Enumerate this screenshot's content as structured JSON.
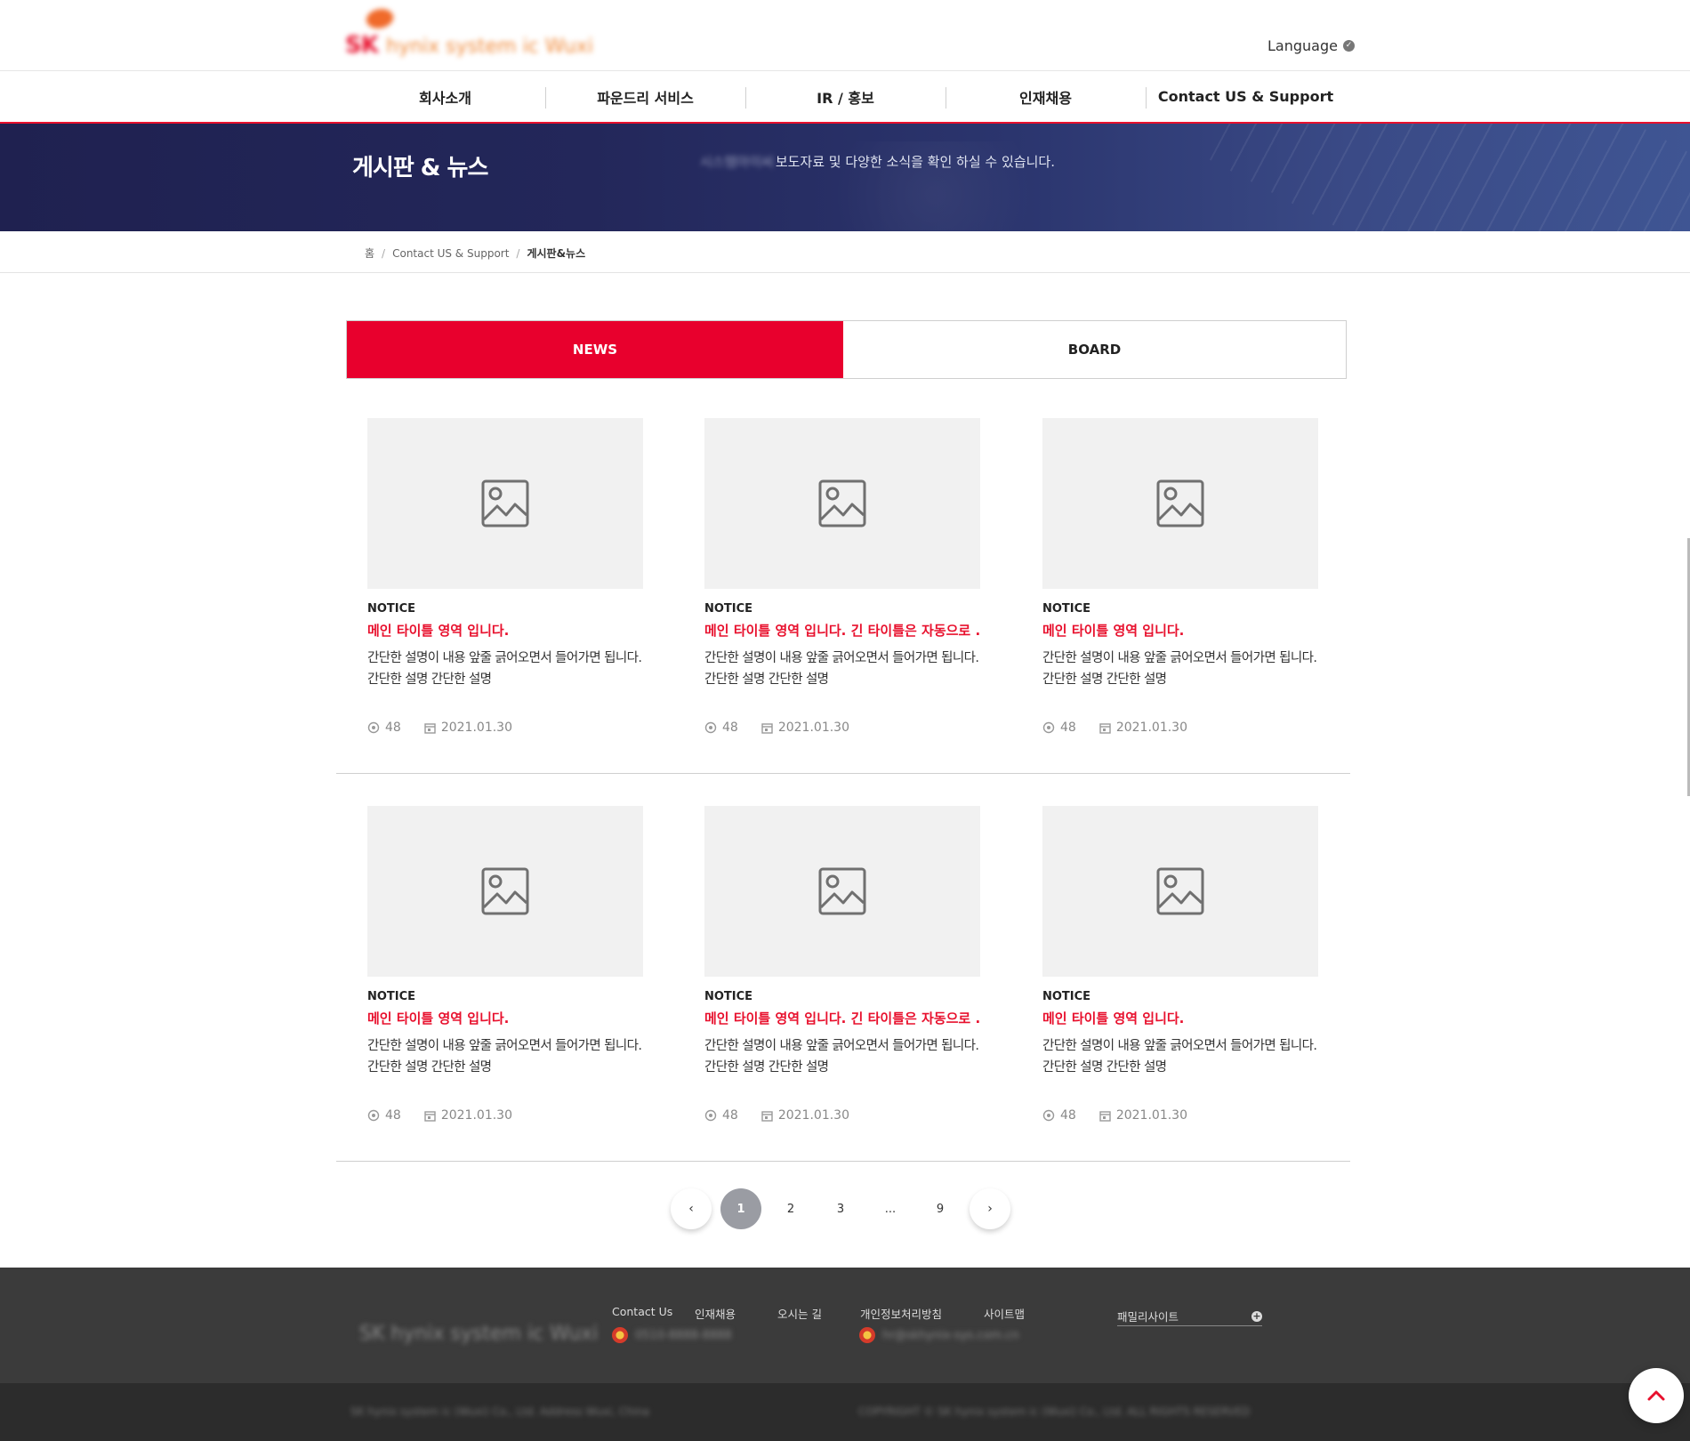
{
  "header": {
    "logo_text": "SK",
    "logo_subtext": "hynix system ic Wuxi",
    "language_label": "Language",
    "nav": [
      "회사소개",
      "파운드리 서비스",
      "IR / 홍보",
      "인재채용",
      "Contact US & Support"
    ]
  },
  "hero": {
    "title": "게시판 & 뉴스",
    "desc_blurred": "시스템아이씨",
    "desc": "보도자료 및 다양한 소식을 확인 하실 수 있습니다."
  },
  "breadcrumb": [
    "홈",
    "Contact US & Support",
    "게시판&뉴스"
  ],
  "tabs": {
    "active": "NEWS",
    "inactive": "BOARD"
  },
  "cards": [
    {
      "category": "NOTICE",
      "title": "메인 타이틀 영역 입니다.",
      "desc": "간단한 설명이 내용 앞줄 긁어오면서 들어가면 됩니다. 간단한 설명 간단한 설명",
      "views": "48",
      "date": "2021.01.30"
    },
    {
      "category": "NOTICE",
      "title": "메인 타이틀 영역 입니다. 긴 타이틀은 자동으로 ...",
      "desc": "간단한 설명이 내용 앞줄 긁어오면서 들어가면 됩니다. 간단한 설명 간단한 설명",
      "views": "48",
      "date": "2021.01.30"
    },
    {
      "category": "NOTICE",
      "title": "메인 타이틀 영역 입니다.",
      "desc": "간단한 설명이 내용 앞줄 긁어오면서 들어가면 됩니다. 간단한 설명 간단한 설명",
      "views": "48",
      "date": "2021.01.30"
    },
    {
      "category": "NOTICE",
      "title": "메인 타이틀 영역 입니다.",
      "desc": "간단한 설명이 내용 앞줄 긁어오면서 들어가면 됩니다. 간단한 설명 간단한 설명",
      "views": "48",
      "date": "2021.01.30"
    },
    {
      "category": "NOTICE",
      "title": "메인 타이틀 영역 입니다. 긴 타이틀은 자동으로 ...",
      "desc": "간단한 설명이 내용 앞줄 긁어오면서 들어가면 됩니다. 간단한 설명 간단한 설명",
      "views": "48",
      "date": "2021.01.30"
    },
    {
      "category": "NOTICE",
      "title": "메인 타이틀 영역 입니다.",
      "desc": "간단한 설명이 내용 앞줄 긁어오면서 들어가면 됩니다. 간단한 설명 간단한 설명",
      "views": "48",
      "date": "2021.01.30"
    }
  ],
  "pagination": {
    "prev": "‹",
    "pages": [
      "1",
      "2",
      "3",
      "...",
      "9"
    ],
    "current": "1",
    "next": "›"
  },
  "footer": {
    "logo_text": "SK hynix system ic Wuxi",
    "links": [
      "Contact Us",
      "인재채용",
      "오시는 길",
      "개인정보처리방침",
      "사이트맵"
    ],
    "contact1_blurred": "0510-8888-8888",
    "contact2_blurred": "hr@skhynix-sys.com.cn",
    "family_site": "패밀리사이트",
    "address_blurred": "SK hynix system ic (Wuxi) Co., Ltd. Address Wuxi, China",
    "copyright_blurred": "COPYRIGHT © SK hynix system ic (Wuxi) Co., Ltd. ALL RIGHTS RESERVED"
  },
  "colors": {
    "accent": "#e8102d",
    "tab_active": "#e8002d",
    "hero_bg": "#23275a",
    "footer_bg": "#3b3b3b",
    "copy_bg": "#2c2c2c",
    "pager_current": "#9a9ca3"
  },
  "icons": {
    "card_thumb": "image-placeholder-icon",
    "views": "eye-icon",
    "date": "calendar-icon",
    "lang": "check-circle-icon",
    "family": "plus-circle-icon",
    "top": "chevron-up-icon"
  }
}
